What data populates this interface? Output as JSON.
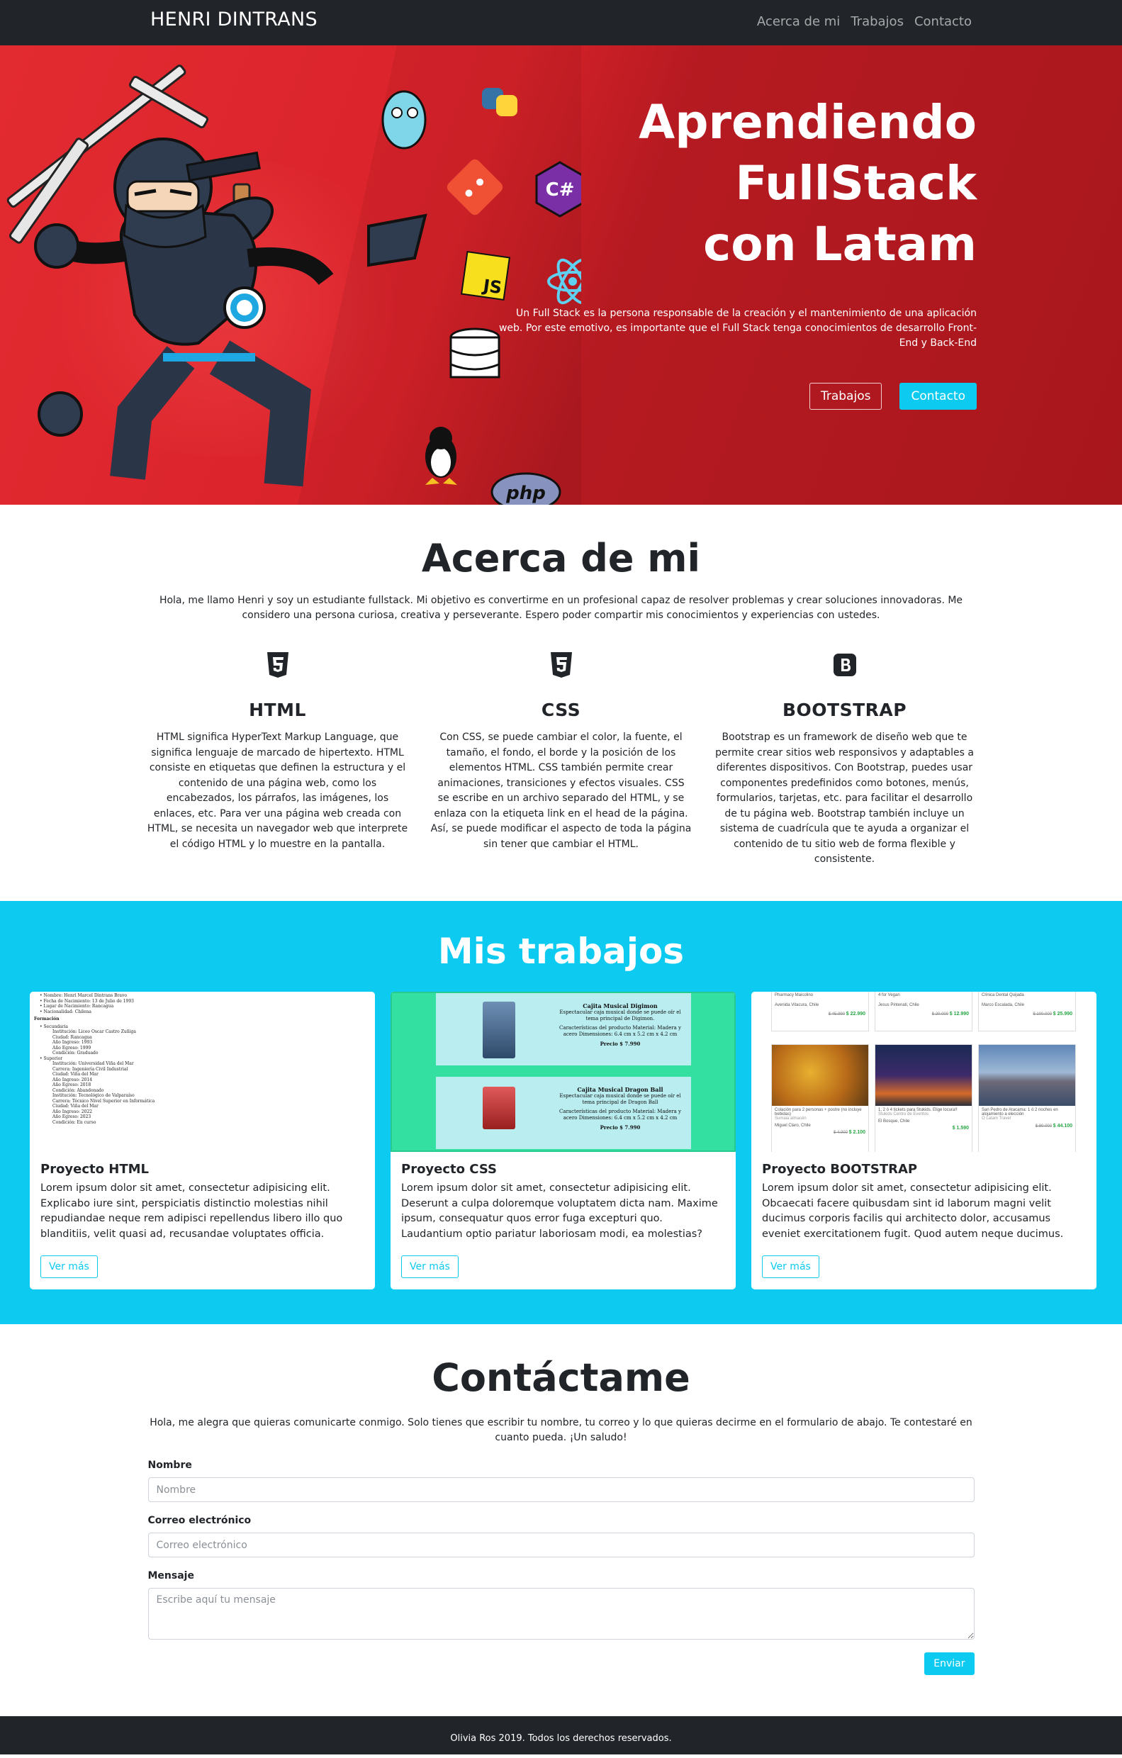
{
  "nav": {
    "brand": "HENRI DINTRANS",
    "links": [
      "Acerca de mi",
      "Trabajos",
      "Contacto"
    ]
  },
  "hero": {
    "title_lines": [
      "Aprendiendo",
      "FullStack",
      "con Latam"
    ],
    "description": "Un Full Stack es la persona responsable de la creación y el mantenimiento de una aplicación web. Por este emotivo, es importante que el Full Stack tenga conocimientos de desarrollo Front-End y Back-End",
    "buttons": {
      "trabajos": "Trabajos",
      "contacto": "Contacto"
    },
    "logo_labels": {
      "js": "JS",
      "php": "php",
      "csharp": "C#"
    }
  },
  "about": {
    "title": "Acerca de mi",
    "intro": "Hola, me llamo Henri y soy un estudiante fullstack. Mi objetivo es convertirme en un profesional capaz de resolver problemas y crear soluciones innovadoras. Me considero una persona curiosa, creativa y perseverante. Espero poder compartir mis conocimientos y experiencias con ustedes.",
    "skills": [
      {
        "icon": "html5-icon",
        "name": "HTML",
        "description": "HTML significa HyperText Markup Language, que significa lenguaje de marcado de hipertexto. HTML consiste en etiquetas que definen la estructura y el contenido de una página web, como los encabezados, los párrafos, las imágenes, los enlaces, etc. Para ver una página web creada con HTML, se necesita un navegador web que interprete el código HTML y lo muestre en la pantalla."
      },
      {
        "icon": "css3-icon",
        "name": "CSS",
        "description": "Con CSS, se puede cambiar el color, la fuente, el tamaño, el fondo, el borde y la posición de los elementos HTML. CSS también permite crear animaciones, transiciones y efectos visuales. CSS se escribe en un archivo separado del HTML, y se enlaza con la etiqueta link en el head de la página. Así, se puede modificar el aspecto de toda la página sin tener que cambiar el HTML."
      },
      {
        "icon": "bootstrap-icon",
        "name": "BOOTSTRAP",
        "description": "Bootstrap es un framework de diseño web que te permite crear sitios web responsivos y adaptables a diferentes dispositivos. Con Bootstrap, puedes usar componentes predefinidos como botones, menús, formularios, tarjetas, etc. para facilitar el desarrollo de tu página web. Bootstrap también incluye un sistema de cuadrícula que te ayuda a organizar el contenido de tu sitio web de forma flexible y consistente."
      }
    ]
  },
  "works": {
    "title": "Mis trabajos",
    "cards": [
      {
        "title": "Proyecto HTML",
        "text": "Lorem ipsum dolor sit amet, consectetur adipisicing elit. Explicabo iure sint, perspiciatis distinctio molestias nihil repudiandae neque rem adipisci repellendus libero illo quo blanditiis, velit quasi ad, recusandae voluptates officia.",
        "button": "Ver más"
      },
      {
        "title": "Proyecto CSS",
        "text": "Lorem ipsum dolor sit amet, consectetur adipisicing elit. Deserunt a culpa doloremque voluptatem dicta nam. Maxime ipsum, consequatur quos error fuga excepturi quo. Laudantium optio pariatur laboriosam modi, ea molestias?",
        "button": "Ver más"
      },
      {
        "title": "Proyecto BOOTSTRAP",
        "text": "Lorem ipsum dolor sit amet, consectetur adipisicing elit. Obcaecati facere quibusdam sint id laborum magni velit ducimus corporis facilis qui architecto dolor, accusamus eveniet exercitationem fugit. Quod autem neque ducimus.",
        "button": "Ver más"
      }
    ],
    "thumb_html": {
      "lines": [
        "• Nombre: Henri Marcel Dintrans Bravo",
        "• Fecha de Nacimiento: 13 de Julio de 1993",
        "• Lugar de Nacimiento: Rancagua",
        "• Nacionalidad: Chilena",
        "Formación",
        "• Secundaria",
        "Institución: Liceo Oscar Castro Zuñiga",
        "Ciudad: Rancagua",
        "Año Ingreso: 1993",
        "Año Egreso: 1999",
        "Condición: Graduado",
        "• Superior",
        "Institución: Universidad Viña del Mar",
        "Carrera: Ingeniería Civil Industrial",
        "Ciudad: Viña del Mar",
        "Año Ingreso: 2014",
        "Año Egreso: 2018",
        "Condición: Abandonado",
        "Institución: Tecnológico de Valparaíso",
        "Carrera: Técnico Nivel Superior en Informática",
        "Ciudad: Viña del Mar",
        "Año Ingreso: 2022",
        "Año Egreso: 2023",
        "Condición: En curso"
      ]
    },
    "thumb_css": {
      "products": [
        {
          "name": "Cajita Musical Digimon",
          "desc": "Espectacular caja musical donde se puede oír el tema principal de Digimon.",
          "details": "Características del producto Material: Madera y acero Dimensiones: 6.4 cm x 5.2 cm x 4.2 cm",
          "price": "Precio $ 7.990"
        },
        {
          "name": "Cajita Musical Dragon Ball",
          "desc": "Espectacular caja musical donde se puede oír el tema principal de Dragon Ball",
          "details": "Características del producto Material: Madera y acero Dimensiones: 6.4 cm x 5.2 cm x 4.2 cm",
          "price": "Precio $ 7.990"
        }
      ]
    },
    "thumb_bootstrap": {
      "top_row": [
        {
          "title": "Pharmacy Maicolino",
          "place": "Avenida Vitacura, Chile",
          "old": "$ 45.990",
          "new": "$ 22.990"
        },
        {
          "title": "4 for Vegan",
          "place": "Jesus Pintenati, Chile",
          "old": "$ 20.000",
          "new": "$ 12.990"
        },
        {
          "title": "Clínica Dental Quijada",
          "place": "Marco Escalada, Chile",
          "old": "$ 100.000",
          "new": "$ 25.990"
        }
      ],
      "bottom_row": [
        {
          "title": "Colación para 2 personas + postre (no incluye bebidas)",
          "sub": "Sumaia almacén",
          "place": "Miguel Claro, Chile",
          "old": "$ 4.000",
          "new": "$ 2.100"
        },
        {
          "title": "1, 2 ó 4 tickets para Stukids. Elige locura!!",
          "sub": "Stukids Centro de Eventos",
          "place": "El Bosque, Chile",
          "old": "",
          "new": "$ 1.590"
        },
        {
          "title": "San Pedro de Atacama: 1 ó 2 noches en alojamiento a elección",
          "sub": "O Latam Travel",
          "place": "",
          "old": "$ 80.000",
          "new": "$ 44.100"
        }
      ]
    }
  },
  "contact": {
    "title": "Contáctame",
    "intro": "Hola, me alegra que quieras comunicarte conmigo. Solo tienes que escribir tu nombre, tu correo y lo que quieras decirme en el formulario de abajo. Te contestaré en cuanto pueda. ¡Un saludo!",
    "fields": {
      "name": {
        "label": "Nombre",
        "placeholder": "Nombre"
      },
      "email": {
        "label": "Correo electrónico",
        "placeholder": "Correo electrónico"
      },
      "message": {
        "label": "Mensaje",
        "placeholder": "Escribe aquí tu mensaje"
      }
    },
    "submit": "Enviar"
  },
  "footer": {
    "text": "Olivia Ros 2019. Todos los derechos reservados."
  },
  "colors": {
    "navbar": "#212529",
    "hero_red": "#d9222a",
    "accent_cyan": "#0dcaf0",
    "text": "#212529"
  }
}
